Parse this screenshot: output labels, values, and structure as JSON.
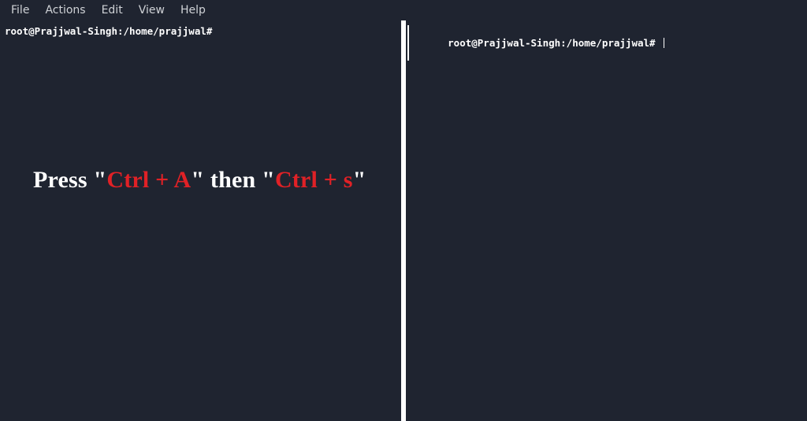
{
  "menubar": {
    "items": [
      "File",
      "Actions",
      "Edit",
      "View",
      "Help"
    ]
  },
  "panes": {
    "left": {
      "prompt": "root@Prajjwal-Singh:/home/prajjwal#"
    },
    "right": {
      "prompt": "root@Prajjwal-Singh:/home/prajjwal# "
    }
  },
  "instruction": {
    "part1": "Press \"",
    "key1": "Ctrl + A",
    "part2": "\" then \"",
    "key2": "Ctrl + s",
    "part3": "\""
  }
}
